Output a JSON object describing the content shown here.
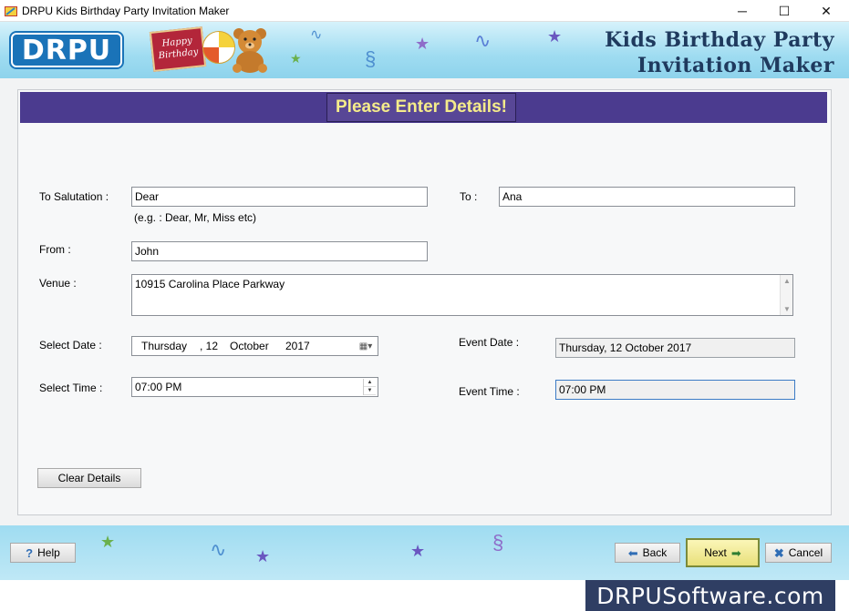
{
  "window": {
    "title": "DRPU Kids Birthday Party Invitation Maker",
    "minimize_glyph": "─",
    "maximize_glyph": "☐",
    "close_glyph": "✕"
  },
  "banner": {
    "logo_text": "DRPU",
    "card_line1": "Happy",
    "card_line2": "Birthday",
    "title_line1": "Kids Birthday Party",
    "title_line2": "Invitation Maker"
  },
  "form": {
    "header": "Please Enter Details!",
    "salutation_label": "To Salutation :",
    "salutation_value": "Dear",
    "salutation_hint": "(e.g. : Dear, Mr, Miss etc)",
    "to_label": "To :",
    "to_value": "Ana",
    "from_label": "From :",
    "from_value": "John",
    "venue_label": "Venue :",
    "venue_value": "10915 Carolina Place Parkway",
    "select_date_label": "Select Date :",
    "date_weekday": "Thursday",
    "date_day": ", 12",
    "date_month": "October",
    "date_year": "2017",
    "event_date_label": "Event Date :",
    "event_date_value": "Thursday, 12 October 2017",
    "select_time_label": "Select Time :",
    "time_value": "07:00 PM",
    "event_time_label": "Event Time :",
    "event_time_value": "07:00 PM",
    "clear_button": "Clear Details"
  },
  "footer": {
    "help_label": "Help",
    "back_label": "Back",
    "next_label": "Next",
    "cancel_label": "Cancel",
    "brand": "DRPUSoftware.com"
  },
  "icons": {
    "help": "question-icon",
    "back": "arrow-left-icon",
    "next": "arrow-right-icon",
    "cancel": "cross-icon",
    "calendar": "calendar-icon"
  },
  "colors": {
    "header_bar": "#4b3b8f",
    "header_text": "#f5ec8a",
    "banner_bg": "#9fdcf1",
    "brand_bg": "#2f3e63"
  }
}
